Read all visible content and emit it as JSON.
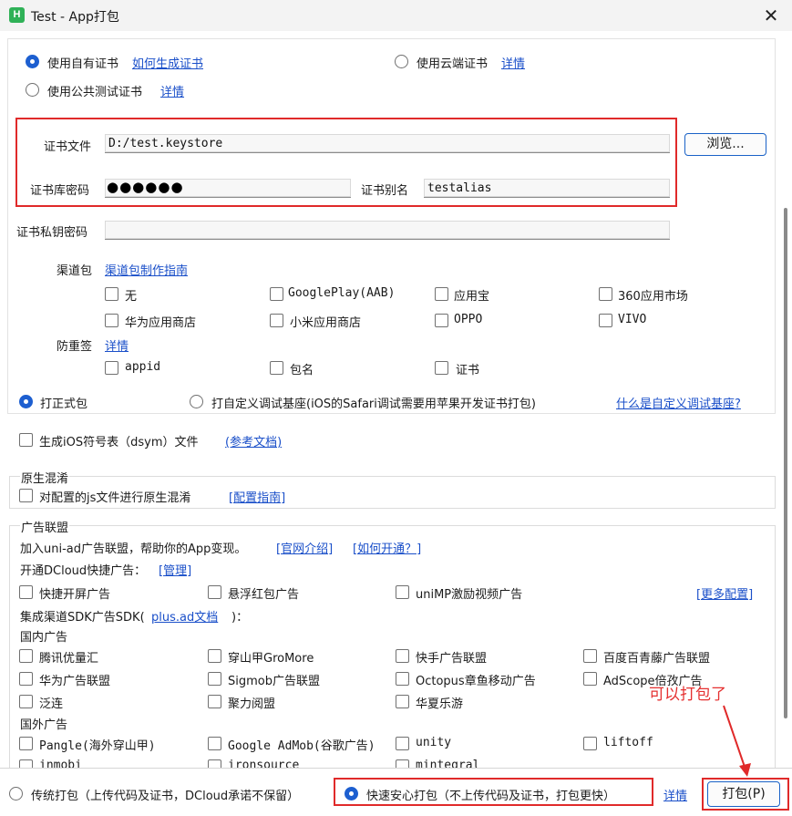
{
  "window": {
    "title": "Test - App打包",
    "icon_text": "H",
    "close_icon": "close-icon"
  },
  "cert_source": {
    "own_cert": "使用自有证书",
    "own_cert_link": "如何生成证书",
    "cloud_cert": "使用云端证书",
    "cloud_cert_link": "详情",
    "public_test_cert": "使用公共测试证书",
    "public_test_link": "详情"
  },
  "cert_form": {
    "file_label": "证书文件",
    "file_value": "D:/test.keystore",
    "browse_button": "浏览...",
    "store_password_label": "证书库密码",
    "store_password_dots": "●●●●●●",
    "alias_label": "证书别名",
    "alias_value": "testalias",
    "private_key_label": "证书私钥密码",
    "private_key_value": ""
  },
  "channels": {
    "label": "渠道包",
    "link": "渠道包制作指南",
    "items": [
      "无",
      "GooglePlay(AAB)",
      "应用宝",
      "360应用市场",
      "华为应用商店",
      "小米应用商店",
      "OPPO",
      "VIVO"
    ]
  },
  "anti_resign": {
    "label": "防重签",
    "link": "详情",
    "items": [
      "appid",
      "包名",
      "证书"
    ]
  },
  "package_type": {
    "formal": "打正式包",
    "custom_base": "打自定义调试基座(iOS的Safari调试需要用苹果开发证书打包)",
    "custom_base_link": "什么是自定义调试基座?"
  },
  "dsym": {
    "label": "生成iOS符号表（dsym）文件",
    "link": "(参考文档)"
  },
  "native_obfuscation": {
    "title": "原生混淆",
    "option": "对配置的js文件进行原生混淆",
    "link": "[配置指南]"
  },
  "ads": {
    "title": "广告联盟",
    "intro": "加入uni-ad广告联盟，帮助你的App变现。",
    "intro_link1": "[官网介绍]",
    "intro_link2": "[如何开通？]",
    "quick_label": "开通DCloud快捷广告：",
    "quick_link": "[管理]",
    "quick_items": [
      "快捷开屏广告",
      "悬浮红包广告",
      "uniMP激励视频广告"
    ],
    "more_config": "[更多配置]",
    "sdk_label_prefix": "集成渠道SDK广告SDK(",
    "sdk_link": "plus.ad文档",
    "sdk_label_suffix": ")：",
    "domestic_title": "国内广告",
    "domestic_items": [
      "腾讯优量汇",
      "穿山甲GroMore",
      "快手广告联盟",
      "百度百青藤广告联盟",
      "华为广告联盟",
      "Sigmob广告联盟",
      "Octopus章鱼移动广告",
      "AdScope倍孜广告",
      "泛连",
      "聚力阅盟",
      "华夏乐游"
    ],
    "overseas_title": "国外广告",
    "overseas_items": [
      "Pangle(海外穿山甲)",
      "Google AdMob(谷歌广告)",
      "unity",
      "liftoff",
      "inmobi",
      "ironsource",
      "mintegral"
    ]
  },
  "bottom": {
    "traditional": "传统打包（上传代码及证书，DCloud承诺不保留）",
    "fast_safe": "快速安心打包（不上传代码及证书，打包更快）",
    "detail_link": "详情",
    "package_button": "打包(P)"
  },
  "annotation": {
    "text": "可以打包了",
    "color": "#e53030"
  }
}
